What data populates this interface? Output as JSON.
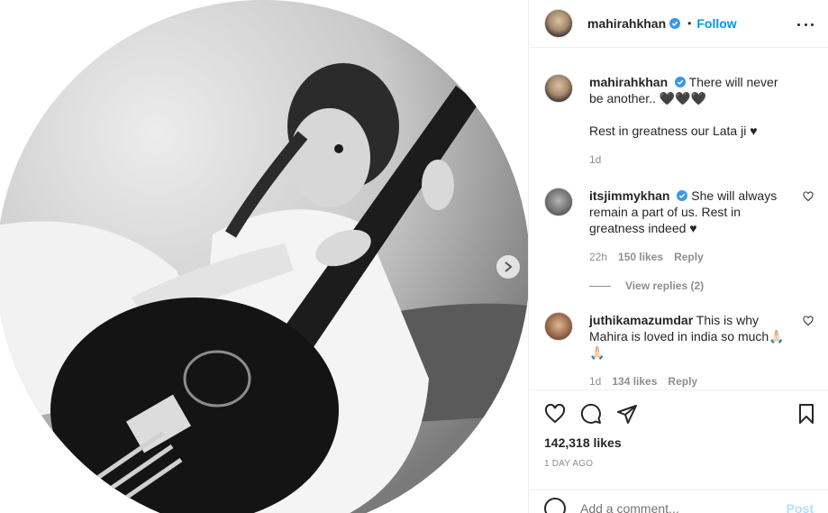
{
  "post": {
    "author": "mahirahkhan",
    "follow_label": "Follow",
    "caption_line1": "There will never be another.. 🖤🖤🖤",
    "caption_line2": "Rest in greatness our Lata ji ♥",
    "caption_age": "1d",
    "likes": "142,318 likes",
    "timestamp": "1 DAY AGO",
    "add_comment_placeholder": "Add a comment...",
    "post_label": "Post"
  },
  "comments": [
    {
      "username": "itsjimmykhan",
      "verified": true,
      "text": "She will always remain a part of us. Rest in greatness indeed ♥",
      "age": "22h",
      "likes": "150 likes",
      "reply_label": "Reply",
      "view_replies": "View replies (2)"
    },
    {
      "username": "juthikamazumdar",
      "verified": false,
      "text": "This is why Mahira is loved in india so much🙏🏻🙏🏻",
      "age": "1d",
      "likes": "134 likes",
      "reply_label": "Reply"
    }
  ],
  "icons": {
    "header_menu": "more-options-icon",
    "verified": "verified-badge-icon",
    "like": "heart-icon",
    "comment": "comment-icon",
    "share": "share-icon",
    "save": "bookmark-icon",
    "next": "chevron-right-icon",
    "emoji": "emoji-icon"
  },
  "colors": {
    "accent": "#0095f6",
    "muted": "#8e8e8e",
    "text": "#262626"
  }
}
